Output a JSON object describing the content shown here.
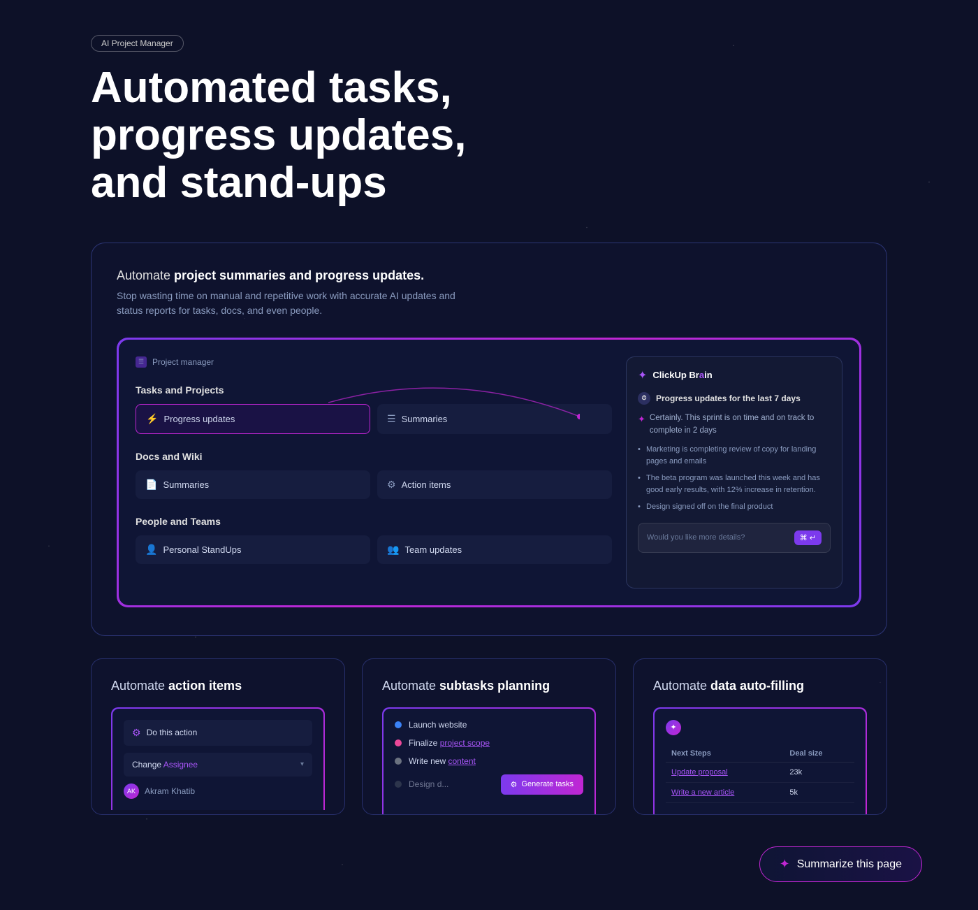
{
  "badge": {
    "label": "AI Project Manager"
  },
  "hero": {
    "title": "Automated tasks, progress updates, and stand-ups"
  },
  "main_section": {
    "title_plain": "Automate ",
    "title_bold": "project summaries and progress updates.",
    "subtitle": "Stop wasting time on manual and repetitive work with accurate AI updates and status reports for tasks, docs, and even people.",
    "mockup": {
      "project_manager_label": "Project manager",
      "tasks_section": "Tasks and Projects",
      "task_cards": [
        {
          "label": "Progress updates",
          "active": true
        },
        {
          "label": "Summaries",
          "active": false
        }
      ],
      "docs_section": "Docs and Wiki",
      "docs_cards": [
        {
          "label": "Summaries"
        },
        {
          "label": "Action items"
        }
      ],
      "people_section": "People and Teams",
      "people_cards": [
        {
          "label": "Personal StandUps"
        },
        {
          "label": "Team updates"
        }
      ],
      "brain_panel": {
        "logo": "ClickUp Brain",
        "query": "Progress updates for the last 7 days",
        "response": "Certainly. This sprint is on time and on track to complete in 2 days",
        "bullets": [
          "Marketing is completing review of copy for landing pages and emails",
          "The beta program was launched this week and has good early results, with 12% increase in retention.",
          "Design signed off on the final product"
        ],
        "input_placeholder": "Would you like more details?",
        "input_btn": "⌘ ↵"
      }
    }
  },
  "feature_cards": [
    {
      "title_plain": "Automate ",
      "title_bold": "action items",
      "mockup": {
        "action_label": "Do this action",
        "dropdown_label": "Change",
        "dropdown_value": "Assignee",
        "user_name": "Akram Khatib"
      }
    },
    {
      "title_plain": "Automate ",
      "title_bold": "subtasks planning",
      "mockup": {
        "tasks": [
          {
            "label": "Launch website",
            "color": "#3b82f6",
            "linked": false
          },
          {
            "label": "Finalize ",
            "link": "project scope",
            "color": "#ec4899",
            "linked": true
          },
          {
            "label": "Write new ",
            "link": "content",
            "color": "#6b7280",
            "linked": true
          },
          {
            "label": "Design d...",
            "color": "#4b5563",
            "linked": false
          }
        ],
        "generate_btn": "Generate tasks"
      }
    },
    {
      "title_plain": "Automate ",
      "title_bold": "data auto-filling",
      "mockup": {
        "columns": [
          "Next Steps",
          "Deal size"
        ],
        "rows": [
          {
            "step": "Update proposal",
            "step_link": true,
            "size": "23k"
          },
          {
            "step": "Write a new article",
            "step_link": true,
            "size": "5k"
          }
        ]
      }
    }
  ],
  "summarize_btn": {
    "label": "Summarize this page",
    "icon": "✦"
  }
}
